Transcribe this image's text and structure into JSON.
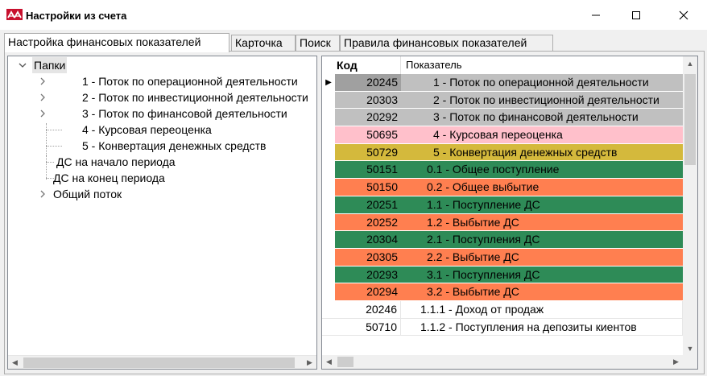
{
  "window": {
    "title": "Настройки из счета",
    "minimize_label": "—",
    "maximize_label": "☐",
    "close_label": "✕"
  },
  "tabs": [
    {
      "label": "Настройка финансовых показателей",
      "active": true
    },
    {
      "label": "Карточка",
      "active": false
    },
    {
      "label": "Поиск",
      "active": false
    },
    {
      "label": "Правила финансовых показателей",
      "active": false
    }
  ],
  "tree": {
    "root": "Папки",
    "items": [
      {
        "label": "1 - Поток по операционной деятельности",
        "expandable": true
      },
      {
        "label": "2 - Поток по инвестиционной деятельности",
        "expandable": true
      },
      {
        "label": "3 - Поток по финансовой деятельности",
        "expandable": true
      },
      {
        "label": "4 - Курсовая переоценка",
        "expandable": false
      },
      {
        "label": "5 - Конвертация денежных средств",
        "expandable": false
      },
      {
        "label": "ДС на начало периода",
        "expandable": false
      },
      {
        "label": "ДС на конец периода",
        "expandable": false
      },
      {
        "label": "Общий поток",
        "expandable": true
      }
    ]
  },
  "grid": {
    "columns": [
      "Код",
      "Показатель"
    ],
    "current_row_marker": "▶",
    "rows": [
      {
        "code": "20245",
        "name": "1 - Поток по операционной деятельности",
        "color": "#c0c0c0",
        "indent": 38,
        "current": true
      },
      {
        "code": "20303",
        "name": "2 - Поток по инвестиционной деятельности",
        "color": "#c0c0c0",
        "indent": 38
      },
      {
        "code": "20292",
        "name": "3 - Поток по финансовой деятельности",
        "color": "#c0c0c0",
        "indent": 38
      },
      {
        "code": "50695",
        "name": "4 - Курсовая переоценка",
        "color": "#ffc0cb",
        "indent": 38
      },
      {
        "code": "50729",
        "name": "5 - Конвертация денежных средств",
        "color": "#d4b93c",
        "indent": 38
      },
      {
        "code": "50151",
        "name": "0.1 - Общее поступление",
        "color": "#2e8b57",
        "indent": 30
      },
      {
        "code": "50150",
        "name": "0.2 - Общее выбытие",
        "color": "#ff7f50",
        "indent": 30
      },
      {
        "code": "20251",
        "name": "1.1 - Поступление ДС",
        "color": "#2e8b57",
        "indent": 30
      },
      {
        "code": "20252",
        "name": "1.2 - Выбытие ДС",
        "color": "#ff7f50",
        "indent": 30
      },
      {
        "code": "20304",
        "name": "2.1 - Поступления ДС",
        "color": "#2e8b57",
        "indent": 30
      },
      {
        "code": "20305",
        "name": "2.2 - Выбытие ДС",
        "color": "#ff7f50",
        "indent": 30
      },
      {
        "code": "20293",
        "name": "3.1 - Поступления ДС",
        "color": "#2e8b57",
        "indent": 30
      },
      {
        "code": "20294",
        "name": "3.2 - Выбытие ДС",
        "color": "#ff7f50",
        "indent": 30
      },
      {
        "code": "20246",
        "name": "1.1.1 - Доход от продаж",
        "color": "#ffffff",
        "indent": 22
      },
      {
        "code": "50710",
        "name": "1.1.2 - Поступления на депозиты киентов",
        "color": "#ffffff",
        "indent": 22
      }
    ]
  }
}
